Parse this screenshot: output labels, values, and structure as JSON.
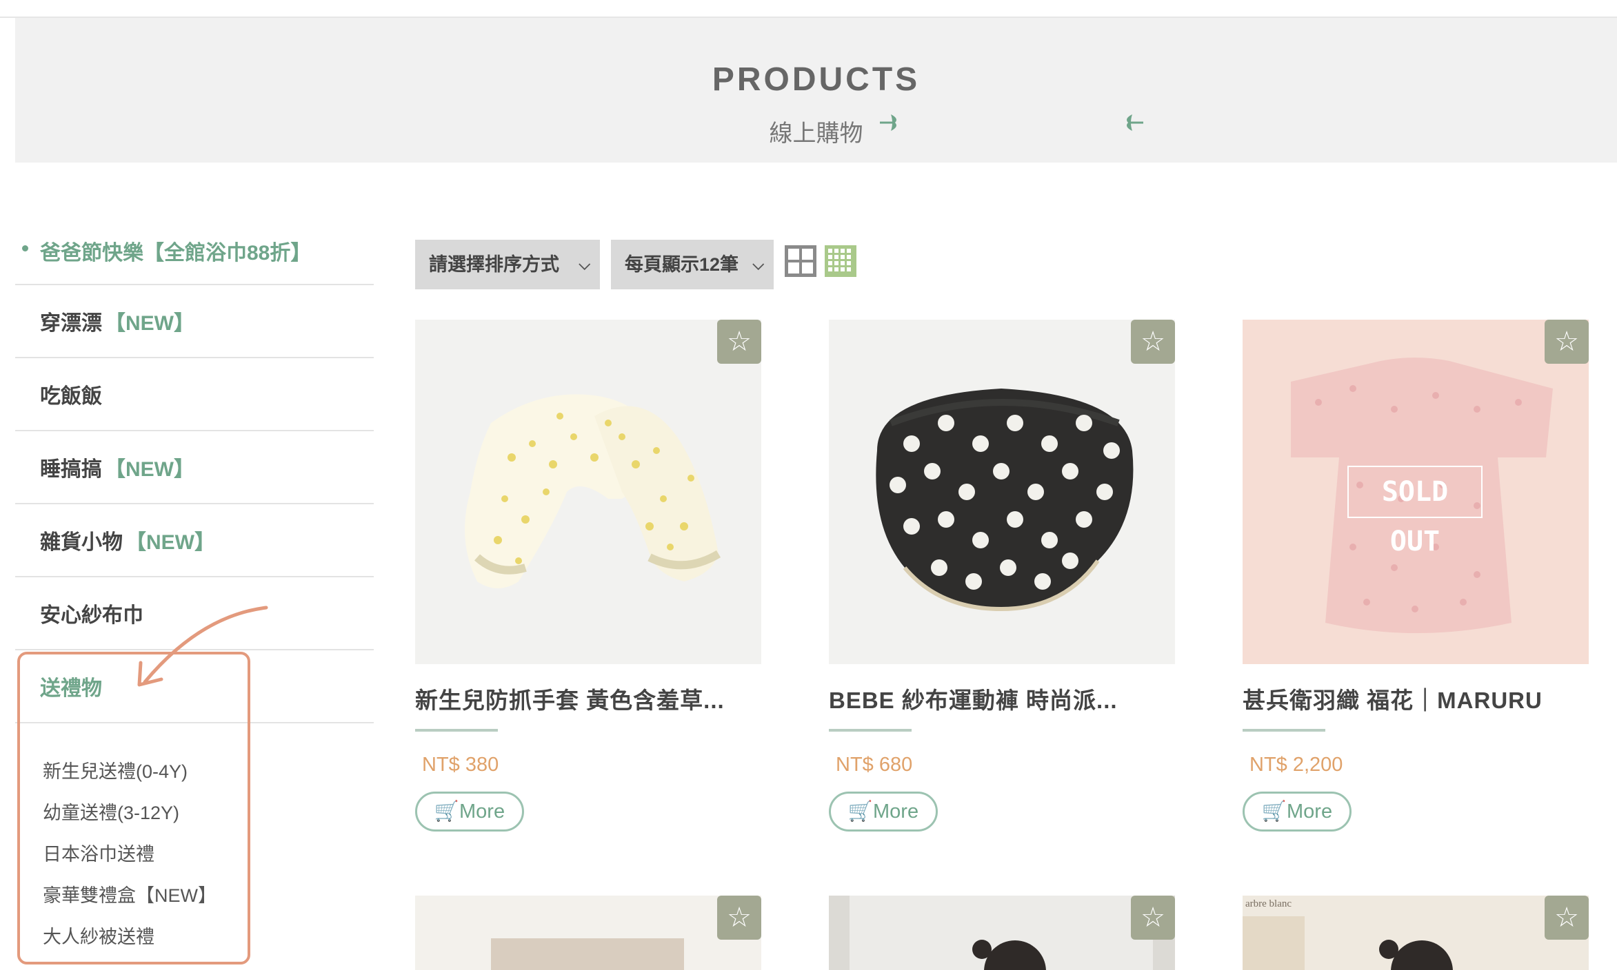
{
  "banner": {
    "title": "PRODUCTS",
    "subtitle": "線上購物"
  },
  "sidebar": {
    "promo": "爸爸節快樂【全館浴巾88折】",
    "items": [
      {
        "label": "穿漂漂",
        "tag": "【NEW】"
      },
      {
        "label": "吃飯飯",
        "tag": ""
      },
      {
        "label": "睡搞搞",
        "tag": "【NEW】"
      },
      {
        "label": "雜貨小物",
        "tag": "【NEW】"
      },
      {
        "label": "安心紗布巾",
        "tag": ""
      },
      {
        "label": "送禮物",
        "tag": ""
      }
    ],
    "subitems": [
      "新生兒送禮(0-4Y)",
      "幼童送禮(3-12Y)",
      "日本浴巾送禮",
      "豪華雙禮盒【NEW】",
      "大人紗被送禮"
    ]
  },
  "toolbar": {
    "sort_label": "請選擇排序方式",
    "per_page_label": "每頁顯示12筆"
  },
  "products": [
    {
      "name": "新生兒防抓手套 黃色含羞草...",
      "price": "NT$ 380",
      "button": "More",
      "sold_out": ""
    },
    {
      "name": "BEBE 紗布運動褲 時尚派...",
      "price": "NT$ 680",
      "button": "More",
      "sold_out": ""
    },
    {
      "name": "甚兵衛羽織 福花｜MARURU",
      "price": "NT$ 2,200",
      "button": "More",
      "sold_out": "SOLD OUT"
    }
  ],
  "product_image_text": {
    "brand_label": "arbre blanc"
  },
  "colors": {
    "accent": "#6fa58a",
    "price": "#e0a26a",
    "annotation": "#e39a7d",
    "fav_bg": "#a3a892"
  }
}
